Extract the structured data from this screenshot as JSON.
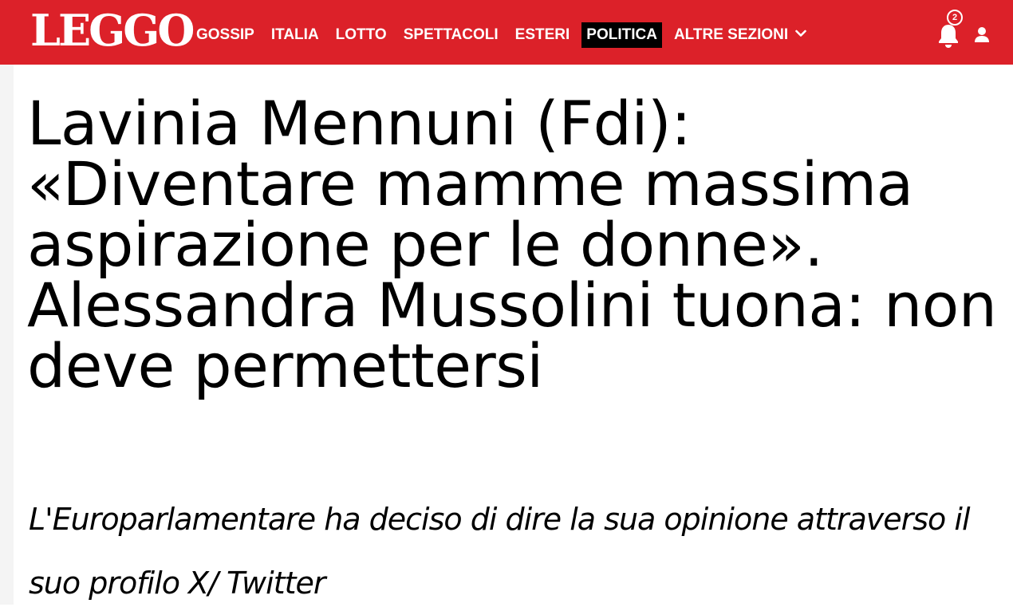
{
  "header": {
    "logo_text": "LEGGO",
    "nav_items": [
      {
        "label": "GOSSIP",
        "active": false
      },
      {
        "label": "ITALIA",
        "active": false
      },
      {
        "label": "LOTTO",
        "active": false
      },
      {
        "label": "SPETTACOLI",
        "active": false
      },
      {
        "label": "ESTERI",
        "active": false
      },
      {
        "label": "POLITICA",
        "active": true
      },
      {
        "label": "ALTRE SEZIONI",
        "active": false
      }
    ],
    "notification_count": "2",
    "brand_color": "#dc2129",
    "icons": {
      "dropdown": "chevron-down-icon",
      "notifications": "bell-icon",
      "account": "user-icon"
    }
  },
  "article": {
    "headline": "Lavinia Mennuni (Fdi): «Diventare mamme massima aspirazione per le donne». Alessandra Mussolini tuona: non deve permettersi",
    "subtitle": "L'Europarlamentare ha deciso di dire la sua opinione attraverso il suo profilo X/ Twitter"
  }
}
